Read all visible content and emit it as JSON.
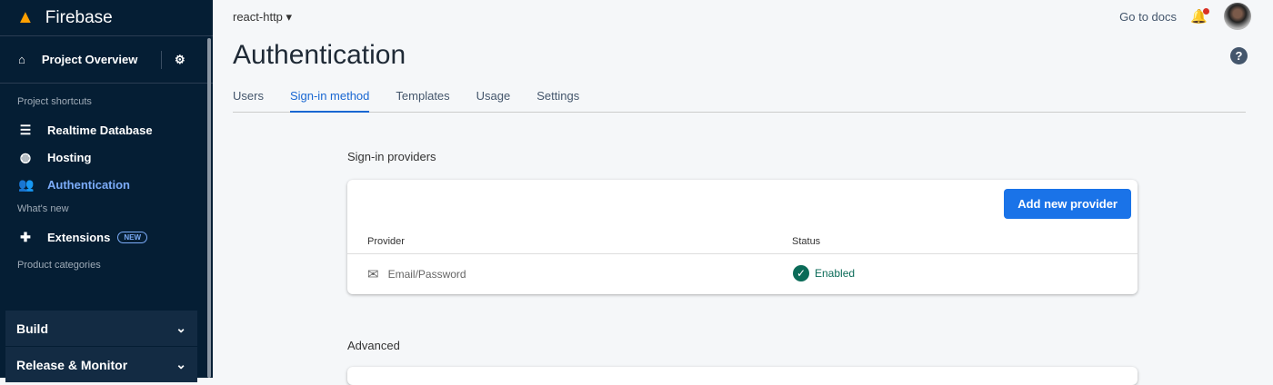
{
  "sidebar": {
    "brand": "Firebase",
    "project_overview": "Project Overview",
    "shortcuts_label": "Project shortcuts",
    "shortcuts": [
      {
        "label": "Realtime Database"
      },
      {
        "label": "Hosting"
      },
      {
        "label": "Authentication"
      }
    ],
    "whats_new_label": "What's new",
    "extensions": "Extensions",
    "new_badge": "NEW",
    "categories_label": "Product categories",
    "categories": [
      {
        "label": "Build"
      },
      {
        "label": "Release & Monitor"
      }
    ]
  },
  "header": {
    "project": "react-http",
    "docs": "Go to docs",
    "title": "Authentication"
  },
  "tabs": [
    {
      "label": "Users"
    },
    {
      "label": "Sign-in method"
    },
    {
      "label": "Templates"
    },
    {
      "label": "Usage"
    },
    {
      "label": "Settings"
    }
  ],
  "providers": {
    "title": "Sign-in providers",
    "add_button": "Add new provider",
    "col_provider": "Provider",
    "col_status": "Status",
    "rows": [
      {
        "provider": "Email/Password",
        "status": "Enabled"
      }
    ]
  },
  "advanced": {
    "title": "Advanced"
  }
}
